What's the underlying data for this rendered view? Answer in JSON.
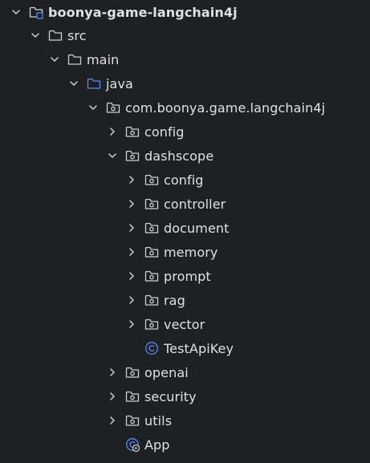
{
  "project_tree": {
    "root": {
      "label": "boonya-game-langchain4j"
    },
    "src": {
      "label": "src"
    },
    "main": {
      "label": "main"
    },
    "java": {
      "label": "java"
    },
    "package": {
      "label": "com.boonya.game.langchain4j"
    },
    "config": {
      "label": "config"
    },
    "dashscope": {
      "label": "dashscope"
    },
    "dashscope_config": {
      "label": "config"
    },
    "dashscope_controller": {
      "label": "controller"
    },
    "dashscope_document": {
      "label": "document"
    },
    "dashscope_memory": {
      "label": "memory"
    },
    "dashscope_prompt": {
      "label": "prompt"
    },
    "dashscope_rag": {
      "label": "rag"
    },
    "dashscope_vector": {
      "label": "vector"
    },
    "test_api_key": {
      "label": "TestApiKey"
    },
    "openai": {
      "label": "openai"
    },
    "security": {
      "label": "security"
    },
    "utils": {
      "label": "utils"
    },
    "app": {
      "label": "App"
    }
  },
  "colors": {
    "background": "#1f2023",
    "text": "#dfe1e5",
    "chevron": "#ced0d6",
    "folder_outline": "#ced0d6",
    "source_folder": "#548af7",
    "module_badge": "#548af7",
    "class_icon": "#548af7"
  },
  "icons": {
    "chevron_expanded": "chevron-down-icon",
    "chevron_collapsed": "chevron-right-icon",
    "folder": "folder-icon",
    "package": "package-icon",
    "source_root": "source-folder-icon",
    "module": "module-folder-icon",
    "class": "class-icon",
    "main_class": "main-class-icon"
  }
}
